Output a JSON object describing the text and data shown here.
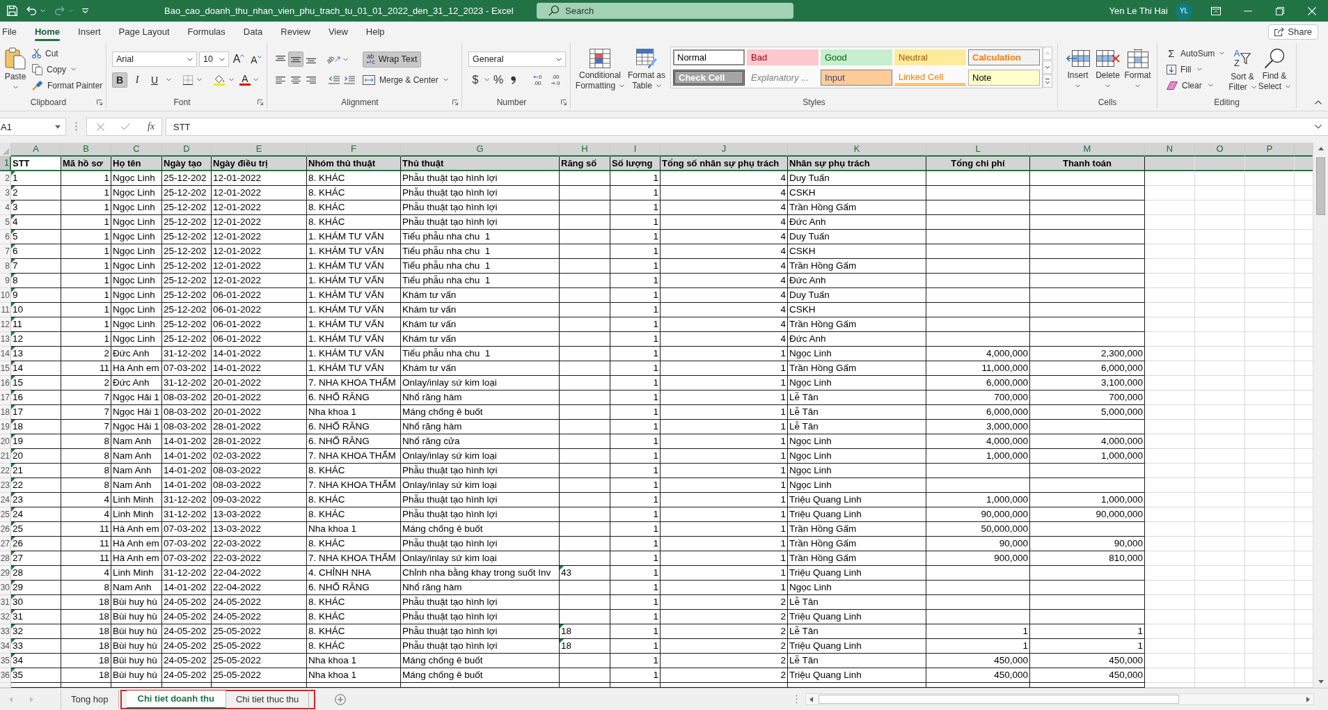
{
  "title_bar": {
    "quick_access": [
      {
        "kind": "save",
        "disabled": false
      },
      {
        "kind": "undo",
        "disabled": false
      },
      {
        "kind": "redo",
        "disabled": true
      },
      {
        "kind": "customize",
        "disabled": false
      }
    ],
    "title": "Bao_cao_doanh_thu_nhan_vien_phu_trach_tu_01_01_2022_den_31_12_2023 - Excel",
    "search": {
      "placeholder": "Search"
    },
    "user": {
      "name": "Yen Le Thi Hai",
      "initials": "YL"
    }
  },
  "menu": {
    "tabs": [
      {
        "label": "File",
        "selected": false
      },
      {
        "label": "Home",
        "selected": true
      },
      {
        "label": "Insert",
        "selected": false
      },
      {
        "label": "Page Layout",
        "selected": false
      },
      {
        "label": "Formulas",
        "selected": false
      },
      {
        "label": "Data",
        "selected": false
      },
      {
        "label": "Review",
        "selected": false
      },
      {
        "label": "View",
        "selected": false
      },
      {
        "label": "Help",
        "selected": false
      }
    ],
    "share": "Share"
  },
  "ribbon": {
    "clipboard": {
      "label": "Clipboard",
      "paste": "Paste",
      "cut": "Cut",
      "copy": "Copy",
      "format_painter": "Format Painter"
    },
    "font": {
      "label": "Font",
      "name": "Arial",
      "size": "10",
      "grow": "A",
      "shrink": "A",
      "styles": [
        {
          "label": "B",
          "kind": "bold",
          "selected": true
        },
        {
          "label": "I",
          "kind": "italic",
          "selected": false
        },
        {
          "label": "U",
          "kind": "underline",
          "selected": false
        }
      ],
      "font_color": "A"
    },
    "alignment": {
      "label": "Alignment",
      "vertical": [
        {
          "kind": "top",
          "selected": false
        },
        {
          "kind": "middle",
          "selected": true
        },
        {
          "kind": "bottom",
          "selected": false
        }
      ],
      "orientation": "ab",
      "wrap_text": {
        "label": "Wrap Text",
        "glyph_top": "ab",
        "glyph_bottom": "c",
        "selected": true
      },
      "horizontal": [
        {
          "kind": "left",
          "selected": false
        },
        {
          "kind": "center",
          "selected": false
        },
        {
          "kind": "right",
          "selected": false
        }
      ],
      "merge": "Merge & Center"
    },
    "number": {
      "label": "Number",
      "format": "General",
      "currency": "$",
      "percent": "%",
      "decimals": [
        {
          "kind": "increase",
          "top": ".0",
          "bottom": ".00"
        },
        {
          "kind": "decrease",
          "top": ".00",
          "bottom": ".0"
        }
      ]
    },
    "styles": {
      "label": "Styles",
      "conditional": [
        "Conditional",
        "Formatting"
      ],
      "format_table": [
        "Format as",
        "Table"
      ],
      "gallery": [
        {
          "label": "Normal",
          "kind": "normal",
          "selected": true
        },
        {
          "label": "Bad",
          "kind": "bad",
          "selected": false
        },
        {
          "label": "Good",
          "kind": "good",
          "selected": false
        },
        {
          "label": "Neutral",
          "kind": "neutral",
          "selected": false
        },
        {
          "label": "Calculation",
          "kind": "calculation",
          "selected": false
        },
        {
          "label": "Check Cell",
          "kind": "check",
          "selected": false
        },
        {
          "label": "Explanatory ...",
          "kind": "explanatory",
          "selected": false
        },
        {
          "label": "Input",
          "kind": "input",
          "selected": false
        },
        {
          "label": "Linked Cell",
          "kind": "linked",
          "selected": false
        },
        {
          "label": "Note",
          "kind": "note",
          "selected": false
        }
      ]
    },
    "cells": {
      "label": "Cells",
      "buttons": [
        {
          "label": "Insert",
          "kind": "insert"
        },
        {
          "label": "Delete",
          "kind": "delete"
        },
        {
          "label": "Format",
          "kind": "format"
        }
      ]
    },
    "editing": {
      "label": "Editing",
      "autosum": {
        "symbol": "Σ",
        "label": "AutoSum"
      },
      "fill": "Fill",
      "clear": "Clear",
      "sort": {
        "top": "A",
        "bottom": "Z",
        "label": [
          "Sort &",
          "Filter"
        ]
      },
      "find": [
        "Find &",
        "Select"
      ]
    }
  },
  "formula_bar": {
    "name_box": "A1",
    "function_label": "fx",
    "formula": "STT"
  },
  "sheet": {
    "columns": [
      {
        "letter": "A",
        "kind": "text"
      },
      {
        "letter": "B",
        "kind": "number"
      },
      {
        "letter": "C",
        "kind": "text"
      },
      {
        "letter": "D",
        "kind": "text"
      },
      {
        "letter": "E",
        "kind": "text"
      },
      {
        "letter": "F",
        "kind": "text"
      },
      {
        "letter": "G",
        "kind": "text"
      },
      {
        "letter": "H",
        "kind": "text"
      },
      {
        "letter": "I",
        "kind": "number"
      },
      {
        "letter": "J",
        "kind": "number"
      },
      {
        "letter": "K",
        "kind": "text"
      },
      {
        "letter": "L",
        "kind": "number"
      },
      {
        "letter": "M",
        "kind": "number"
      },
      {
        "letter": "N",
        "kind": "blank"
      },
      {
        "letter": "O",
        "kind": "blank"
      },
      {
        "letter": "P",
        "kind": "blank"
      }
    ],
    "header_row": {
      "row": "1",
      "selected": true,
      "cells": [
        {
          "text": "STT",
          "shaded": false,
          "centered": false
        },
        {
          "text": "Mã hồ sơ",
          "shaded": true,
          "centered": false
        },
        {
          "text": "Họ tên",
          "shaded": true,
          "centered": false
        },
        {
          "text": "Ngày tạo",
          "shaded": true,
          "centered": false
        },
        {
          "text": "Ngày điều trị",
          "shaded": true,
          "centered": false
        },
        {
          "text": "Nhóm thủ thuật",
          "shaded": true,
          "centered": false
        },
        {
          "text": "Thủ thuật",
          "shaded": true,
          "centered": false
        },
        {
          "text": "Răng số",
          "shaded": true,
          "centered": false
        },
        {
          "text": "Số lượng",
          "shaded": true,
          "centered": false
        },
        {
          "text": "Tổng số nhân sự phụ trách",
          "shaded": true,
          "centered": false
        },
        {
          "text": "Nhân sự phụ trách",
          "shaded": true,
          "centered": false
        },
        {
          "text": "Tổng chi phí",
          "shaded": true,
          "centered": true
        },
        {
          "text": "Thanh toán",
          "shaded": true,
          "centered": true
        },
        {
          "shaded": true
        },
        {
          "shaded": true
        },
        {
          "shaded": true
        }
      ]
    },
    "rows": [
      {
        "row": "2",
        "selected": false,
        "cells": [
          {
            "text": "1",
            "flag": true
          },
          "1",
          "Ngọc Linh",
          "25-12-202",
          "12-01-2022",
          "8. KHÁC",
          "Phẫu thuật tạo hình lợi",
          null,
          "1",
          "4",
          "Duy Tuấn",
          null,
          null
        ]
      },
      {
        "row": "3",
        "selected": false,
        "cells": [
          {
            "text": "2",
            "flag": true
          },
          "1",
          "Ngọc Linh",
          "25-12-202",
          "12-01-2022",
          "8. KHÁC",
          "Phẫu thuật tạo hình lợi",
          null,
          "1",
          "4",
          "CSKH",
          null,
          null
        ]
      },
      {
        "row": "4",
        "selected": false,
        "cells": [
          {
            "text": "3",
            "flag": true
          },
          "1",
          "Ngọc Linh",
          "25-12-202",
          "12-01-2022",
          "8. KHÁC",
          "Phẫu thuật tạo hình lợi",
          null,
          "1",
          "4",
          "Trần Hồng Gấm",
          null,
          null
        ]
      },
      {
        "row": "5",
        "selected": false,
        "cells": [
          {
            "text": "4",
            "flag": true
          },
          "1",
          "Ngọc Linh",
          "25-12-202",
          "12-01-2022",
          "8. KHÁC",
          "Phẫu thuật tạo hình lợi",
          null,
          "1",
          "4",
          "Đức Anh",
          null,
          null
        ]
      },
      {
        "row": "6",
        "selected": false,
        "cells": [
          {
            "text": "5",
            "flag": true
          },
          "1",
          "Ngọc Linh",
          "25-12-202",
          "12-01-2022",
          "1. KHÁM TƯ VẤN",
          "Tiểu phẫu nha chu  1",
          null,
          "1",
          "4",
          "Duy Tuấn",
          null,
          null
        ]
      },
      {
        "row": "7",
        "selected": false,
        "cells": [
          {
            "text": "6",
            "flag": true
          },
          "1",
          "Ngọc Linh",
          "25-12-202",
          "12-01-2022",
          "1. KHÁM TƯ VẤN",
          "Tiểu phẫu nha chu  1",
          null,
          "1",
          "4",
          "CSKH",
          null,
          null
        ]
      },
      {
        "row": "8",
        "selected": false,
        "cells": [
          {
            "text": "7",
            "flag": true
          },
          "1",
          "Ngọc Linh",
          "25-12-202",
          "12-01-2022",
          "1. KHÁM TƯ VẤN",
          "Tiểu phẫu nha chu  1",
          null,
          "1",
          "4",
          "Trần Hồng Gấm",
          null,
          null
        ]
      },
      {
        "row": "9",
        "selected": false,
        "cells": [
          {
            "text": "8",
            "flag": true
          },
          "1",
          "Ngọc Linh",
          "25-12-202",
          "12-01-2022",
          "1. KHÁM TƯ VẤN",
          "Tiểu phẫu nha chu  1",
          null,
          "1",
          "4",
          "Đức Anh",
          null,
          null
        ]
      },
      {
        "row": "10",
        "selected": false,
        "cells": [
          {
            "text": "9",
            "flag": true
          },
          "1",
          "Ngọc Linh",
          "25-12-202",
          "06-01-2022",
          "1. KHÁM TƯ VẤN",
          "Khám tư vấn",
          null,
          "1",
          "4",
          "Duy Tuấn",
          null,
          null
        ]
      },
      {
        "row": "11",
        "selected": false,
        "cells": [
          {
            "text": "10",
            "flag": true
          },
          "1",
          "Ngọc Linh",
          "25-12-202",
          "06-01-2022",
          "1. KHÁM TƯ VẤN",
          "Khám tư vấn",
          null,
          "1",
          "4",
          "CSKH",
          null,
          null
        ]
      },
      {
        "row": "12",
        "selected": false,
        "cells": [
          {
            "text": "11",
            "flag": true
          },
          "1",
          "Ngọc Linh",
          "25-12-202",
          "06-01-2022",
          "1. KHÁM TƯ VẤN",
          "Khám tư vấn",
          null,
          "1",
          "4",
          "Trần Hồng Gấm",
          null,
          null
        ]
      },
      {
        "row": "13",
        "selected": false,
        "cells": [
          {
            "text": "12",
            "flag": true
          },
          "1",
          "Ngọc Linh",
          "25-12-202",
          "06-01-2022",
          "1. KHÁM TƯ VẤN",
          "Khám tư vấn",
          null,
          "1",
          "4",
          "Đức Anh",
          null,
          null
        ]
      },
      {
        "row": "14",
        "selected": false,
        "cells": [
          {
            "text": "13",
            "flag": true
          },
          "2",
          "Đức Anh",
          "31-12-202",
          "14-01-2022",
          "1. KHÁM TƯ VẤN",
          "Tiểu phẫu nha chu  1",
          null,
          "1",
          "1",
          "Ngọc Linh",
          "4,000,000",
          "2,300,000"
        ]
      },
      {
        "row": "15",
        "selected": false,
        "cells": [
          {
            "text": "14",
            "flag": true
          },
          "11",
          "Hà Anh em",
          "07-03-202",
          "14-01-2022",
          "1. KHÁM TƯ VẤN",
          "Khám tư vấn",
          null,
          "1",
          "1",
          "Trần Hồng Gấm",
          "11,000,000",
          "6,000,000"
        ]
      },
      {
        "row": "16",
        "selected": false,
        "cells": [
          {
            "text": "15",
            "flag": true
          },
          "2",
          "Đức Anh",
          "31-12-202",
          "20-01-2022",
          "7. NHA KHOA THẨM",
          "Onlay/inlay sứ kim loại",
          null,
          "1",
          "1",
          "Ngọc Linh",
          "6,000,000",
          "3,100,000"
        ]
      },
      {
        "row": "17",
        "selected": false,
        "cells": [
          {
            "text": "16",
            "flag": true
          },
          "7",
          "Ngọc Hải 1",
          "08-03-202",
          "20-01-2022",
          "6. NHỔ RĂNG",
          "Nhổ răng hàm",
          null,
          "1",
          "1",
          "Lễ Tân",
          "700,000",
          "700,000"
        ]
      },
      {
        "row": "18",
        "selected": false,
        "cells": [
          {
            "text": "17",
            "flag": true
          },
          "7",
          "Ngọc Hải 1",
          "08-03-202",
          "20-01-2022",
          "Nha khoa 1",
          "Máng chống ê buốt",
          null,
          "1",
          "1",
          "Lễ Tân",
          "6,000,000",
          "5,000,000"
        ]
      },
      {
        "row": "19",
        "selected": false,
        "cells": [
          {
            "text": "18",
            "flag": true
          },
          "7",
          "Ngọc Hải 1",
          "08-03-202",
          "28-01-2022",
          "6. NHỔ RĂNG",
          "Nhổ răng hàm",
          null,
          "1",
          "1",
          "Lễ Tân",
          "3,000,000",
          null
        ]
      },
      {
        "row": "20",
        "selected": false,
        "cells": [
          {
            "text": "19",
            "flag": true
          },
          "8",
          "Nam Anh",
          "14-01-202",
          "28-01-2022",
          "6. NHỔ RĂNG",
          "Nhổ răng cửa",
          null,
          "1",
          "1",
          "Ngọc Linh",
          "4,000,000",
          "4,000,000"
        ]
      },
      {
        "row": "21",
        "selected": false,
        "cells": [
          {
            "text": "20",
            "flag": true
          },
          "8",
          "Nam Anh",
          "14-01-202",
          "02-03-2022",
          "7. NHA KHOA THẨM",
          "Onlay/inlay sứ kim loại",
          null,
          "1",
          "1",
          "Ngọc Linh",
          "1,000,000",
          "1,000,000"
        ]
      },
      {
        "row": "22",
        "selected": false,
        "cells": [
          {
            "text": "21",
            "flag": true
          },
          "8",
          "Nam Anh",
          "14-01-202",
          "08-03-2022",
          "8. KHÁC",
          "Phẫu thuật tạo hình lợi",
          null,
          "1",
          "1",
          "Ngọc Linh",
          null,
          null
        ]
      },
      {
        "row": "23",
        "selected": false,
        "cells": [
          {
            "text": "22",
            "flag": true
          },
          "8",
          "Nam Anh",
          "14-01-202",
          "08-03-2022",
          "7. NHA KHOA THẨM",
          "Onlay/inlay sứ kim loại",
          null,
          "1",
          "1",
          "Ngọc Linh",
          null,
          null
        ]
      },
      {
        "row": "24",
        "selected": false,
        "cells": [
          {
            "text": "23",
            "flag": true
          },
          "4",
          "Linh Minh",
          "31-12-202",
          "09-03-2022",
          "8. KHÁC",
          "Phẫu thuật tạo hình lợi",
          null,
          "1",
          "1",
          "Triệu Quang Linh",
          "1,000,000",
          "1,000,000"
        ]
      },
      {
        "row": "25",
        "selected": false,
        "cells": [
          {
            "text": "24",
            "flag": true
          },
          "4",
          "Linh Minh",
          "31-12-202",
          "13-03-2022",
          "8. KHÁC",
          "Phẫu thuật tạo hình lợi",
          null,
          "1",
          "1",
          "Triệu Quang Linh",
          "90,000,000",
          "90,000,000"
        ]
      },
      {
        "row": "26",
        "selected": false,
        "cells": [
          {
            "text": "25",
            "flag": true
          },
          "11",
          "Hà Anh em",
          "07-03-202",
          "13-03-2022",
          "Nha khoa 1",
          "Máng chống ê buốt",
          null,
          "1",
          "1",
          "Trần Hồng Gấm",
          "50,000,000",
          null
        ]
      },
      {
        "row": "27",
        "selected": false,
        "cells": [
          {
            "text": "26",
            "flag": true
          },
          "11",
          "Hà Anh em",
          "07-03-202",
          "22-03-2022",
          "8. KHÁC",
          "Phẫu thuật tạo hình lợi",
          null,
          "1",
          "1",
          "Trần Hồng Gấm",
          "90,000",
          "90,000"
        ]
      },
      {
        "row": "28",
        "selected": false,
        "cells": [
          {
            "text": "27",
            "flag": true
          },
          "11",
          "Hà Anh em",
          "07-03-202",
          "22-03-2022",
          "7. NHA KHOA THẨM",
          "Onlay/inlay sứ kim loại",
          null,
          "1",
          "1",
          "Trần Hồng Gấm",
          "900,000",
          "810,000"
        ]
      },
      {
        "row": "29",
        "selected": false,
        "cells": [
          {
            "text": "28",
            "flag": true
          },
          "4",
          "Linh Minh",
          "31-12-202",
          "22-04-2022",
          "4. CHỈNH NHA",
          "Chỉnh nha bằng khay trong suốt Inv",
          {
            "text": "43",
            "flag": true
          },
          "1",
          "1",
          "Triệu Quang Linh",
          null,
          null
        ]
      },
      {
        "row": "30",
        "selected": false,
        "cells": [
          {
            "text": "29",
            "flag": true
          },
          "8",
          "Nam Anh",
          "14-01-202",
          "22-04-2022",
          "6. NHỔ RĂNG",
          "Nhổ răng hàm",
          null,
          "1",
          "1",
          "Ngọc Linh",
          null,
          null
        ]
      },
      {
        "row": "31",
        "selected": false,
        "cells": [
          {
            "text": "30",
            "flag": true
          },
          "18",
          "Bùi huy hù",
          "24-05-202",
          "24-05-2022",
          "8. KHÁC",
          "Phẫu thuật tạo hình lợi",
          null,
          "1",
          "2",
          "Lễ Tân",
          null,
          null
        ]
      },
      {
        "row": "32",
        "selected": false,
        "cells": [
          {
            "text": "31",
            "flag": true
          },
          "18",
          "Bùi huy hù",
          "24-05-202",
          "24-05-2022",
          "8. KHÁC",
          "Phẫu thuật tạo hình lợi",
          null,
          "1",
          "2",
          "Triệu Quang Linh",
          null,
          null
        ]
      },
      {
        "row": "33",
        "selected": false,
        "cells": [
          {
            "text": "32",
            "flag": true
          },
          "18",
          "Bùi huy hù",
          "24-05-202",
          "25-05-2022",
          "8. KHÁC",
          "Phẫu thuật tạo hình lợi",
          {
            "text": "18",
            "flag": true
          },
          "1",
          "2",
          "Lễ Tân",
          "1",
          "1"
        ]
      },
      {
        "row": "34",
        "selected": false,
        "cells": [
          {
            "text": "33",
            "flag": true
          },
          "18",
          "Bùi huy hù",
          "24-05-202",
          "25-05-2022",
          "8. KHÁC",
          "Phẫu thuật tạo hình lợi",
          {
            "text": "18",
            "flag": true
          },
          "1",
          "2",
          "Triệu Quang Linh",
          "1",
          "1"
        ]
      },
      {
        "row": "35",
        "selected": false,
        "cells": [
          {
            "text": "34",
            "flag": true
          },
          "18",
          "Bùi huy hù",
          "24-05-202",
          "25-05-2022",
          "Nha khoa 1",
          "Máng chống ê buốt",
          null,
          "1",
          "2",
          "Lễ Tân",
          "450,000",
          "450,000"
        ]
      },
      {
        "row": "36",
        "selected": false,
        "cells": [
          {
            "text": "35",
            "flag": true
          },
          "18",
          "Bùi huy hù",
          "24-05-202",
          "25-05-2022",
          "Nha khoa 1",
          "Máng chống ê buốt",
          null,
          "1",
          "2",
          "Triệu Quang Linh",
          "450,000",
          "450,000"
        ]
      }
    ]
  },
  "sheet_tabs": {
    "nav": [
      {
        "kind": "previous",
        "disabled": true
      },
      {
        "kind": "next",
        "disabled": true
      }
    ],
    "tabs": [
      {
        "label": "Tong hop",
        "selected": false,
        "highlighted": false
      },
      {
        "label": "Chi tiet doanh thu",
        "selected": true,
        "highlighted": true
      },
      {
        "label": "Chi tiet thuc thu",
        "selected": false,
        "highlighted": true
      }
    ]
  }
}
